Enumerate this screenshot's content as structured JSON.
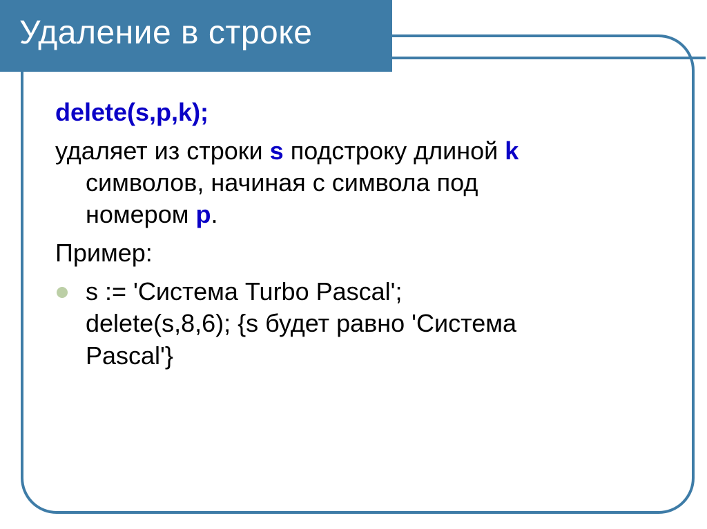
{
  "title": "Удаление в строке",
  "func": {
    "sig": "delete(s,p,k);"
  },
  "desc": {
    "pre": "удаляет из строки ",
    "s": "s",
    "mid1": " подстроку длиной ",
    "k": "k",
    "line2a": "символов, начиная с символа под",
    "line3a": "номером ",
    "p": "p",
    "end": "."
  },
  "example_label": "Пример:",
  "example": {
    "line1": "s := 'Система Turbo Pascal';",
    "line2": "delete(s,8,6); {s будет равно 'Система",
    "line3": "Pascal'}"
  }
}
